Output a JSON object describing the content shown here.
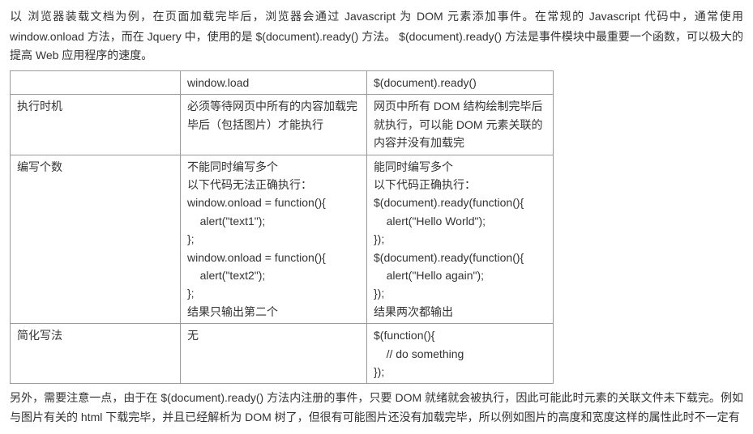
{
  "intro": {
    "first": "以",
    "text": "浏览器装载文档为例，在页面加载完毕后，浏览器会通过 Javascript 为 DOM 元素添加事件。在常规的 Javascript 代码中，通常使用 window.onload 方法，而在 Jquery 中，使用的是 $(document).ready() 方法。 $(document).ready() 方法是事件模块中最重要一个函数，可以极大的提高 Web 应用程序的速度。"
  },
  "table": {
    "headers": {
      "c0": "",
      "c1": "window.load",
      "c2": "$(document).ready()"
    },
    "rows": {
      "timing": {
        "label": "执行时机",
        "c1": "必须等待网页中所有的内容加载完毕后（包括图片）才能执行",
        "c2": "网页中所有 DOM 结构绘制完毕后就执行，可以能 DOM 元素关联的内容并没有加载完"
      },
      "count": {
        "label": "编写个数",
        "c1": "不能同时编写多个\n以下代码无法正确执行：\nwindow.onload = function(){\n    alert(\"text1\");\n};\nwindow.onload = function(){\n    alert(\"text2\");\n};\n结果只输出第二个",
        "c2": "能同时编写多个\n以下代码正确执行：\n$(document).ready(function(){\n    alert(\"Hello World\");\n});\n$(document).ready(function(){\n    alert(\"Hello again\");\n});\n结果两次都输出"
      },
      "short": {
        "label": "简化写法",
        "c1": "无",
        "c2": "$(function(){\n    // do something\n});"
      }
    }
  },
  "footer": "另外，需要注意一点，由于在 $(document).ready() 方法内注册的事件，只要 DOM 就绪就会被执行，因此可能此时元素的关联文件未下载完。例如与图片有关的 html 下载完毕，并且已经解析为 DOM 树了，但很有可能图片还没有加载完毕，所以例如图片的高度和宽度这样的属性此时不一定有"
}
